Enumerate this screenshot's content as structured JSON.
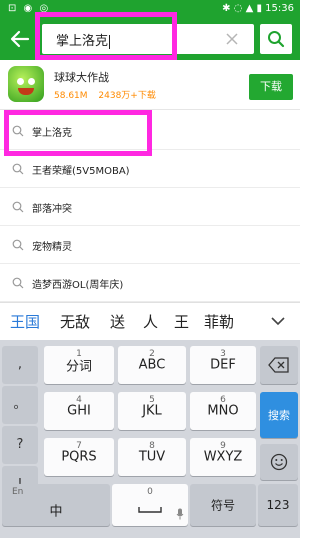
{
  "status_bar": {
    "left_icons": "⊡ ◉ ◎",
    "right_text": "✱ ◌ ▲ ▮ 15:36"
  },
  "search": {
    "value": "掌上洛克"
  },
  "app": {
    "name": "球球大作战",
    "size": "58.61M",
    "downloads": "2438万+下载",
    "download_label": "下载"
  },
  "suggestions": [
    {
      "label": "掌上洛克"
    },
    {
      "label": "王者荣耀(5V5MOBA)"
    },
    {
      "label": "部落冲突"
    },
    {
      "label": "宠物精灵"
    },
    {
      "label": "造梦西游OL(周年庆)"
    }
  ],
  "candidates": [
    "王国",
    "无敌",
    "送",
    "人",
    "王",
    "菲勒"
  ],
  "keyboard": {
    "side_keys": [
      ",",
      "。",
      "?",
      "!",
      "~"
    ],
    "row1": [
      {
        "main": "分词",
        "sub": "1"
      },
      {
        "main": "ABC",
        "sub": "2"
      },
      {
        "main": "DEF",
        "sub": "3"
      }
    ],
    "row2": [
      {
        "main": "GHI",
        "sub": "4"
      },
      {
        "main": "JKL",
        "sub": "5"
      },
      {
        "main": "MNO",
        "sub": "6"
      }
    ],
    "row3": [
      {
        "main": "PQRS",
        "sub": "7"
      },
      {
        "main": "TUV",
        "sub": "8"
      },
      {
        "main": "WXYZ",
        "sub": "9"
      }
    ],
    "search_key": "搜索",
    "bottom": {
      "left_top": "En",
      "left_main": "中",
      "space_sub": "0",
      "symbol": "符号",
      "num": "123"
    }
  },
  "colors": {
    "header_green": "#1fa32f",
    "highlight": "#ff28e1",
    "meta_orange": "#ff8a00",
    "search_blue": "#2f8fe0"
  }
}
